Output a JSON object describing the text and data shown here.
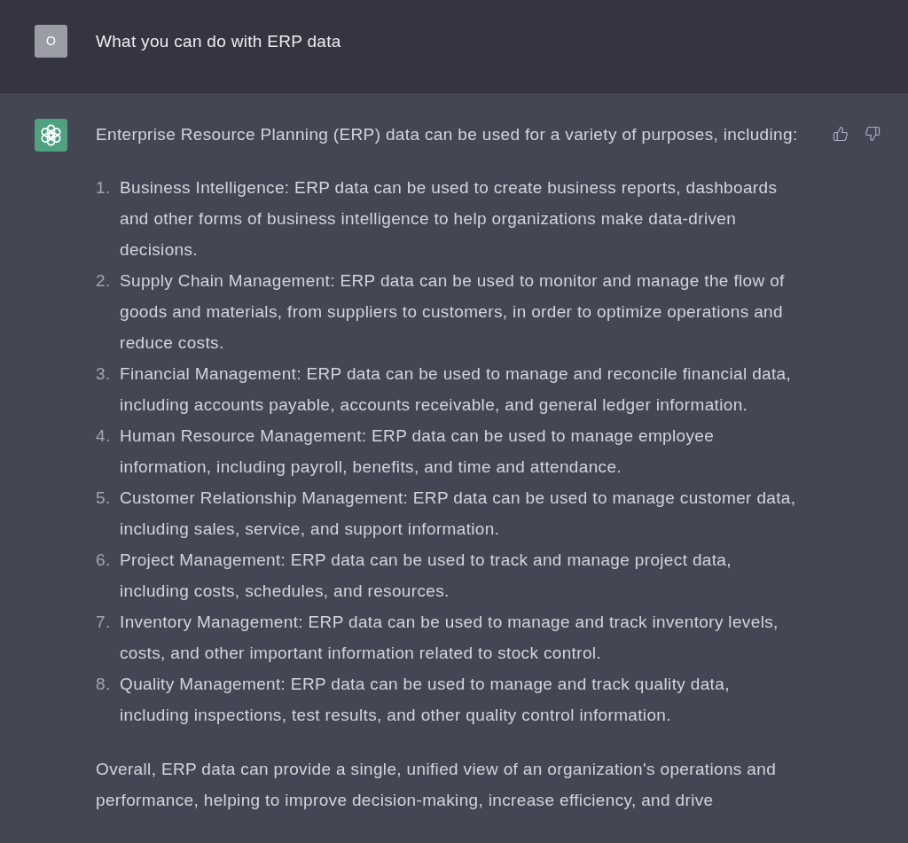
{
  "user_message": {
    "avatar_letter": "O",
    "text": "What you can do with ERP data"
  },
  "assistant_message": {
    "intro": "Enterprise Resource Planning (ERP) data can be used for a variety of purposes, including:",
    "items": [
      {
        "number": "1.",
        "text": "Business Intelligence: ERP data can be used to create business reports, dashboards and other forms of business intelligence to help organizations make data-driven decisions."
      },
      {
        "number": "2.",
        "text": "Supply Chain Management: ERP data can be used to monitor and manage the flow of goods and materials, from suppliers to customers, in order to optimize operations and reduce costs."
      },
      {
        "number": "3.",
        "text": "Financial Management: ERP data can be used to manage and reconcile financial data, including accounts payable, accounts receivable, and general ledger information."
      },
      {
        "number": "4.",
        "text": "Human Resource Management: ERP data can be used to manage employee information, including payroll, benefits, and time and attendance."
      },
      {
        "number": "5.",
        "text": "Customer Relationship Management: ERP data can be used to manage customer data, including sales, service, and support information."
      },
      {
        "number": "6.",
        "text": "Project Management: ERP data can be used to track and manage project data, including costs, schedules, and resources."
      },
      {
        "number": "7.",
        "text": "Inventory Management: ERP data can be used to manage and track inventory levels, costs, and other important information related to stock control."
      },
      {
        "number": "8.",
        "text": "Quality Management: ERP data can be used to manage and track quality data, including inspections, test results, and other quality control information."
      }
    ],
    "conclusion": "Overall, ERP data can provide a single, unified view of an organization's operations and performance, helping to improve decision-making, increase efficiency, and drive"
  }
}
